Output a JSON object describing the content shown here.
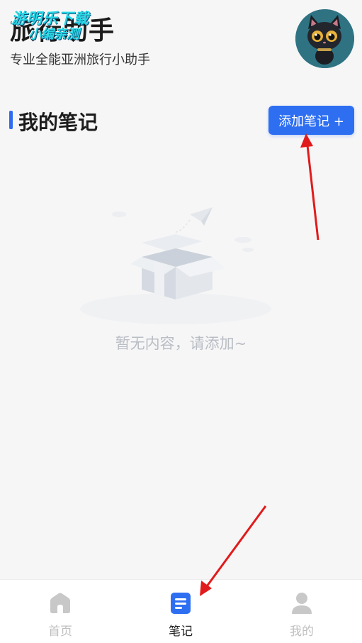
{
  "header": {
    "title": "旅行助手",
    "subtitle": "专业全能亚洲旅行小助手",
    "watermark_line1": "游明乐下载",
    "watermark_line2": "小编亲测"
  },
  "notes": {
    "section_title": "我的笔记",
    "add_button_label": "添加笔记 +",
    "empty_text": "暂无内容，请添加~"
  },
  "tabbar": {
    "items": [
      {
        "label": "首页",
        "icon": "home-icon",
        "active": false
      },
      {
        "label": "笔记",
        "icon": "notes-icon",
        "active": true
      },
      {
        "label": "我的",
        "icon": "user-icon",
        "active": false
      }
    ]
  },
  "colors": {
    "accent": "#2e6ff2",
    "arrow": "#e11b1b",
    "background": "#f6f6f7"
  }
}
